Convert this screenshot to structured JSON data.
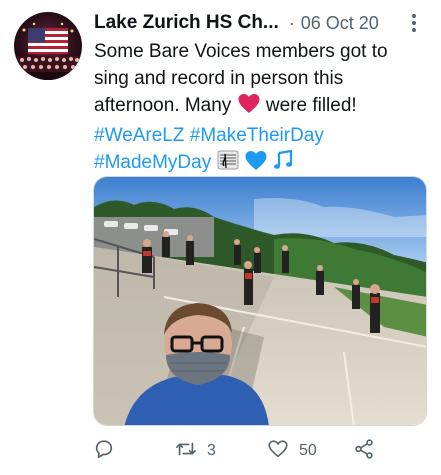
{
  "account": {
    "name": "Lake Zurich HS Ch...",
    "separator": "·",
    "date": "06 Oct 20"
  },
  "tweet": {
    "text_line1": "Some Bare Voices members got to",
    "text_line2": "sing and record in person this",
    "text_line3_a": "afternoon. Many",
    "text_line3_b": "were filled!",
    "hashtag_1": "#WeAreLZ",
    "hashtag_2": "#MakeTheirDay",
    "hashtag_3": "#MadeMyDay",
    "emojis": [
      "red-heart",
      "musical-score",
      "blue-heart",
      "musical-notes"
    ]
  },
  "actions": {
    "reply_count": "",
    "retweet_count": "3",
    "like_count": "50",
    "share_count": ""
  },
  "colors": {
    "link": "#1d9bf0",
    "text": "#0f1419",
    "muted": "#536471",
    "heart_red": "#e0245e",
    "heart_blue": "#1d9bf0"
  }
}
